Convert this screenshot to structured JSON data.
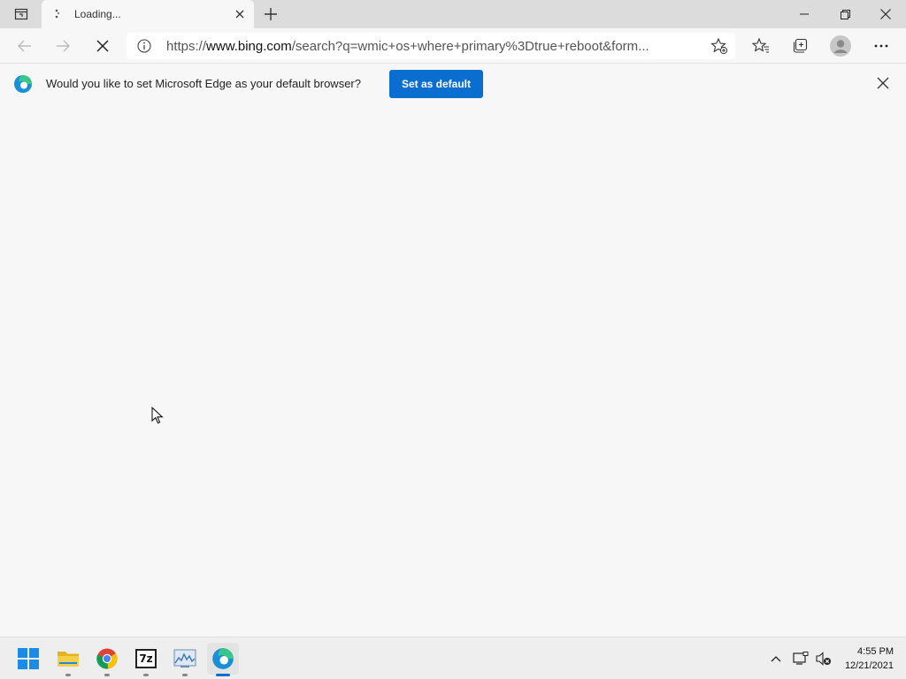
{
  "browser": {
    "tab": {
      "title": "Loading..."
    },
    "address_bar": {
      "url_prefix": "https://",
      "url_host": "www.bing.com",
      "url_rest": "/search?q=wmic+os+where+primary%3Dtrue+reboot&form..."
    }
  },
  "infobar": {
    "message": "Would you like to set Microsoft Edge as your default browser?",
    "button_label": "Set as default"
  },
  "taskbar": {
    "apps": [
      "start-icon",
      "file-explorer-icon",
      "chrome-icon",
      "7zip-icon",
      "monitor-app-icon",
      "edge-icon"
    ],
    "app_7zip_label": "7z",
    "clock_time": "4:55 PM",
    "clock_date": "12/21/2021"
  },
  "colors": {
    "accent": "#0a6ed1",
    "tabstrip": "#dcdcdc",
    "background": "#f7f7f7"
  }
}
